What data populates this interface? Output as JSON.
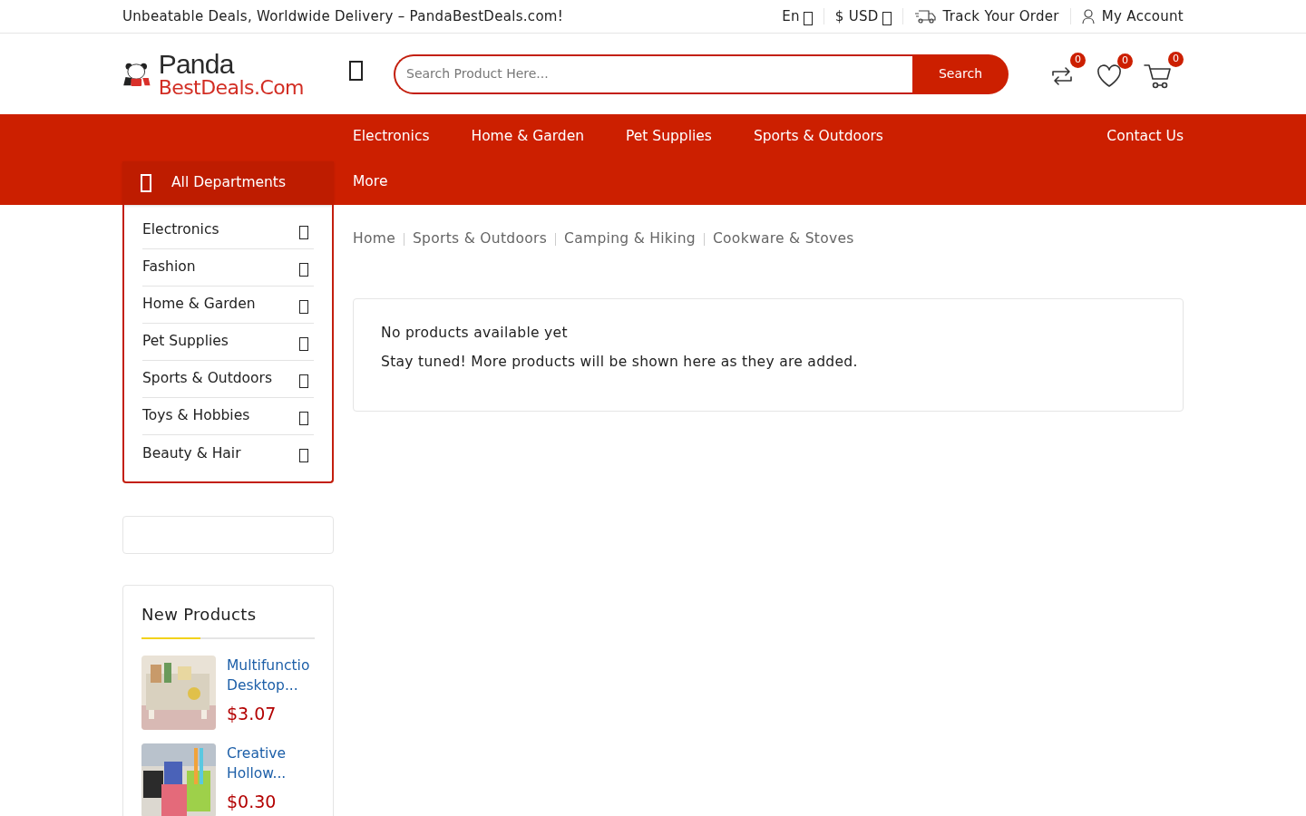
{
  "top_bar": {
    "tagline": "Unbeatable Deals, Worldwide Delivery – PandaBestDeals.com!",
    "language": "En",
    "currency": "$ USD",
    "track_order": "Track Your Order",
    "account": "My Account"
  },
  "header": {
    "logo": {
      "line_1": "Panda",
      "line_2": "BestDeals.Com"
    },
    "search": {
      "placeholder": "Search Product Here...",
      "button": "Search"
    },
    "counters": [
      {
        "kind": "compare",
        "count": "0"
      },
      {
        "kind": "wishlist",
        "count": "0"
      },
      {
        "kind": "cart",
        "count": "0"
      }
    ]
  },
  "nav": {
    "departments_label": "All Departments",
    "items": [
      "Electronics",
      "Home & Garden",
      "Pet Supplies",
      "Sports & Outdoors"
    ],
    "more": "More",
    "contact": "Contact Us"
  },
  "departments": [
    "Electronics",
    "Fashion",
    "Home & Garden",
    "Pet Supplies",
    "Sports & Outdoors",
    "Toys & Hobbies",
    "Beauty & Hair"
  ],
  "new_products": {
    "title": "New Products",
    "items": [
      {
        "name": "Multifunctio",
        "name_2": "Desktop...",
        "price": "$3.07",
        "kind": "picture"
      },
      {
        "name": "Creative",
        "name_2": "Hollow...",
        "price": "$0.30",
        "kind": "picture"
      }
    ]
  },
  "breadcrumb": [
    "Home",
    "Sports & Outdoors",
    "Camping & Hiking",
    "Cookware & Stoves"
  ],
  "notice": {
    "title": "No products available yet",
    "text": "Stay tuned! More products will be shown here as they are added."
  }
}
